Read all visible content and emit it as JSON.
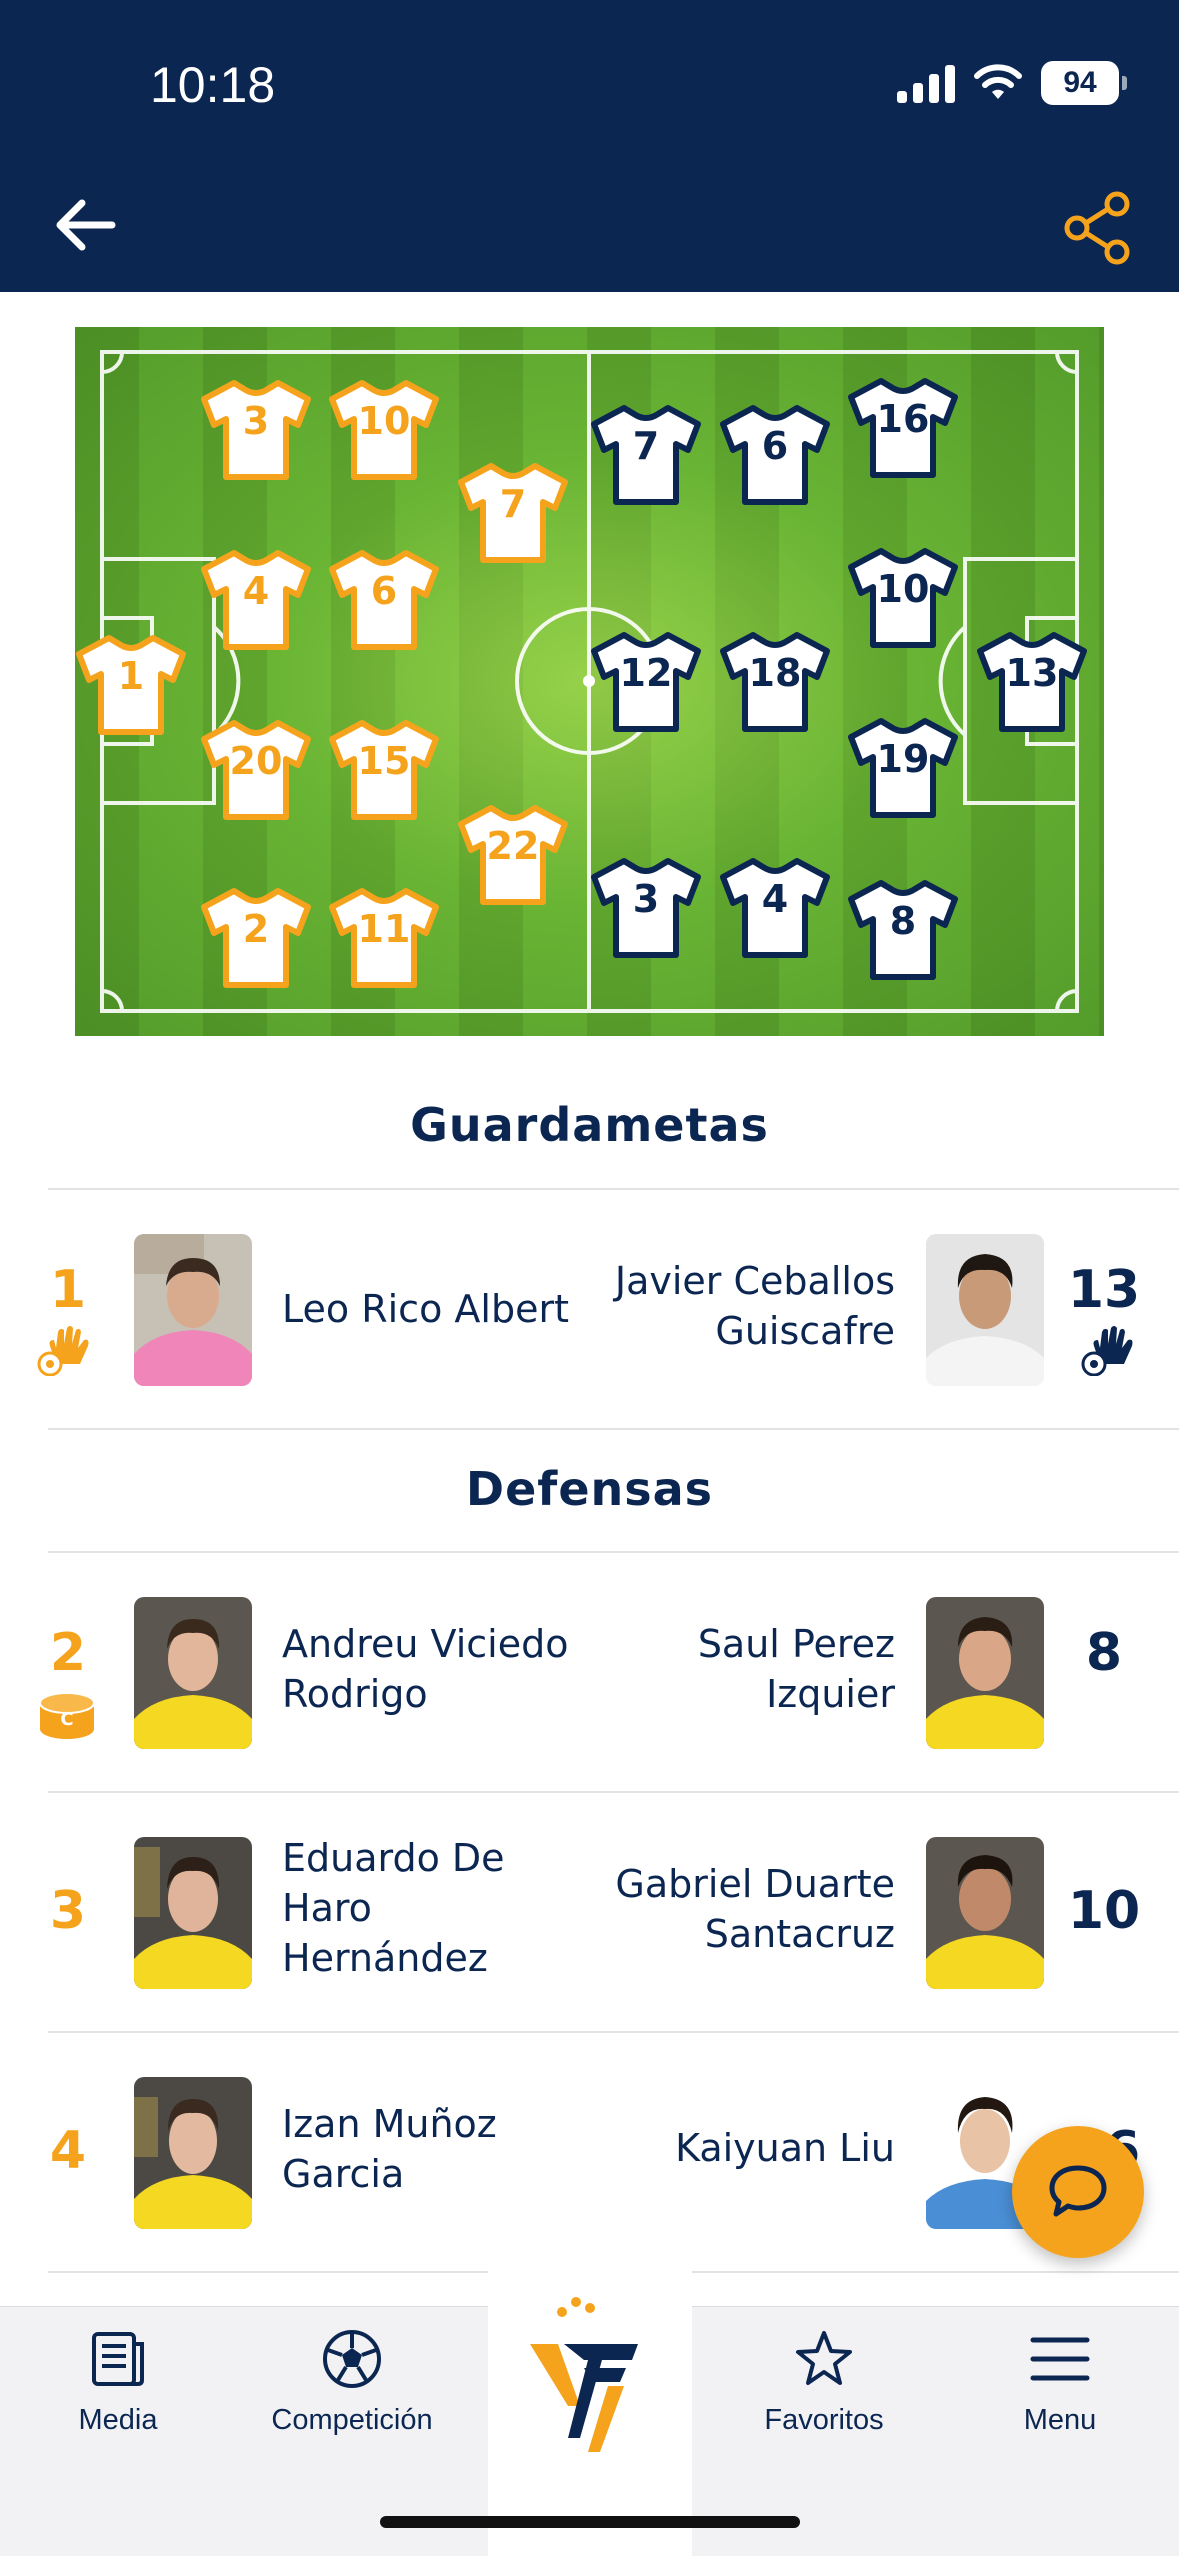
{
  "status_bar": {
    "time": "10:18",
    "battery": "94"
  },
  "header": {
    "back_icon": "arrow-left-icon",
    "share_icon": "share-icon"
  },
  "colors": {
    "navy": "#0c2652",
    "orange": "#f5a31c",
    "pitch_green": "#5aa02e"
  },
  "pitch": {
    "home_numbers": [
      "3",
      "10",
      "7",
      "4",
      "6",
      "1",
      "20",
      "15",
      "22",
      "2",
      "11"
    ],
    "away_numbers": [
      "7",
      "6",
      "16",
      "10",
      "12",
      "18",
      "13",
      "19",
      "3",
      "4",
      "8"
    ]
  },
  "sections": [
    {
      "title": "Guardametas",
      "rows": [
        {
          "home_number": "1",
          "home_name": "Leo Rico Albert",
          "home_badge": "goalkeeper-glove-icon",
          "away_number": "13",
          "away_name": "Javier Ceballos Guiscafre",
          "away_badge": "goalkeeper-glove-icon"
        }
      ]
    },
    {
      "title": "Defensas",
      "rows": [
        {
          "home_number": "2",
          "home_name": "Andreu Viciedo Rodrigo",
          "home_badge": "captain-armband-icon",
          "away_number": "8",
          "away_name": "Saul Perez Izquier"
        },
        {
          "home_number": "3",
          "home_name": "Eduardo De Haro Hernández",
          "away_number": "10",
          "away_name": "Gabriel Duarte Santacruz"
        },
        {
          "home_number": "4",
          "home_name": "Izan Muñoz Garcia",
          "away_number": "16",
          "away_name": "Kaiyuan Liu"
        }
      ]
    }
  ],
  "chat_button": {
    "icon": "chat-bubble-icon"
  },
  "bottom_nav": {
    "items": [
      {
        "label": "Media",
        "icon": "newspaper-icon"
      },
      {
        "label": "Competición",
        "icon": "soccer-ball-icon"
      },
      {
        "label": "",
        "icon": "ffcv-logo-icon"
      },
      {
        "label": "Favoritos",
        "icon": "star-icon"
      },
      {
        "label": "Menu",
        "icon": "hamburger-menu-icon"
      }
    ]
  }
}
